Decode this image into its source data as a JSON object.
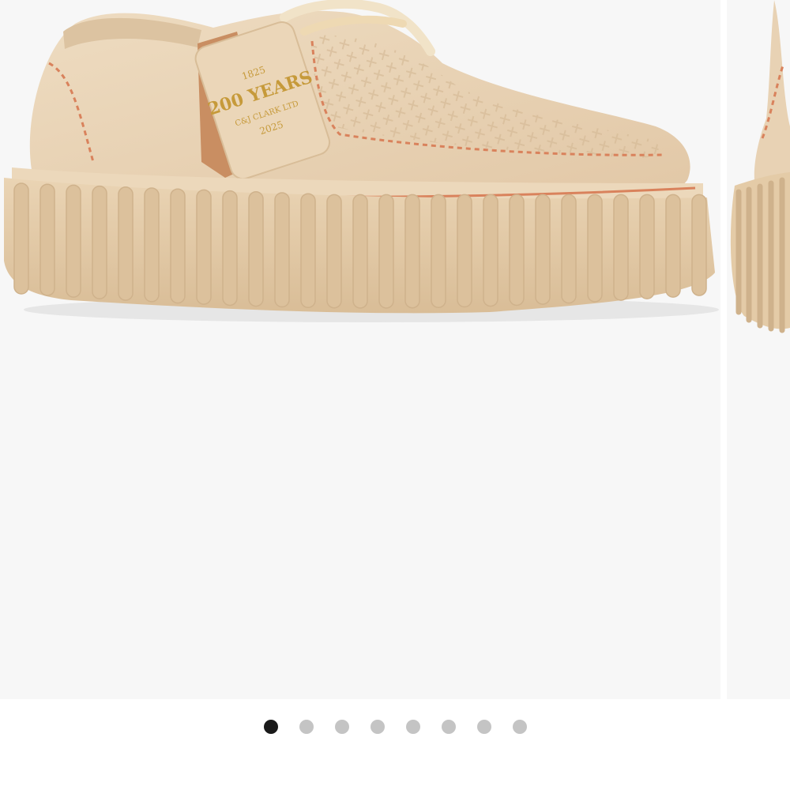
{
  "product_image": {
    "alt": "",
    "tag_text_1": "200 YEARS",
    "tag_text_2": "C&J CLARK LTD",
    "tag_year_left": "1825",
    "tag_year_right": "2025"
  },
  "colors": {
    "slide_bg": "#f7f7f7",
    "suede": "#e8d2b4",
    "sole": "#e4cba7",
    "stitch": "#d9825c",
    "leather_tag": "#c98e62",
    "dot_active": "#1a1a1a",
    "dot_inactive": "#c4c4c4"
  },
  "pagination": {
    "count": 8,
    "active_index": 0,
    "dots": [
      {
        "label": "Slide 1"
      },
      {
        "label": "Slide 2"
      },
      {
        "label": "Slide 3"
      },
      {
        "label": "Slide 4"
      },
      {
        "label": "Slide 5"
      },
      {
        "label": "Slide 6"
      },
      {
        "label": "Slide 7"
      },
      {
        "label": "Slide 8"
      }
    ]
  }
}
